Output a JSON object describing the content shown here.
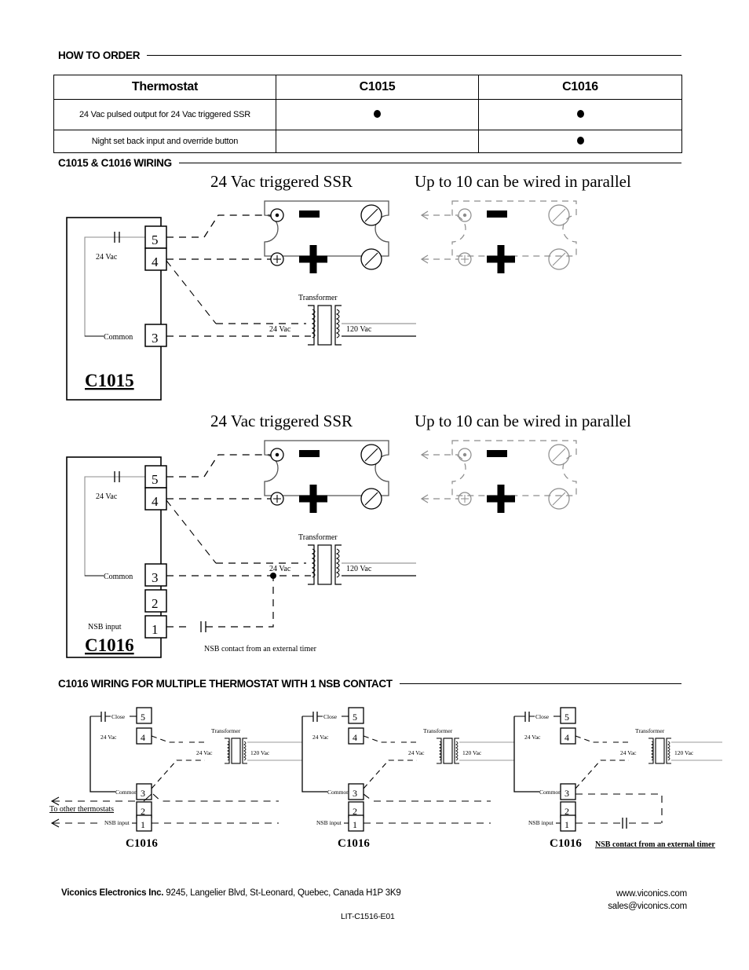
{
  "sections": {
    "how_to_order": "HOW TO ORDER",
    "wiring": "C1015 & C1016 WIRING",
    "multi": "C1016 WIRING FOR MULTIPLE THERMOSTAT WITH 1 NSB CONTACT"
  },
  "order_table": {
    "headers": [
      "Thermostat",
      "C1015",
      "C1016"
    ],
    "rows": [
      {
        "feature": "24 Vac pulsed output for 24 Vac triggered SSR",
        "c1015": true,
        "c1016": true
      },
      {
        "feature": "Night set back input and override button",
        "c1015": false,
        "c1016": true
      }
    ]
  },
  "diagram1": {
    "title_ssr": "24 Vac triggered SSR",
    "title_parallel": "Up to 10 can be wired in parallel",
    "model": "C1015",
    "terminals": [
      "5",
      "4",
      "3"
    ],
    "label_24vac": "24 Vac",
    "label_common": "Common",
    "transformer": "Transformer",
    "xfmr_primary": "24 Vac",
    "xfmr_secondary": "120 Vac",
    "ssr_minus": "−",
    "ssr_plus": "+"
  },
  "diagram2": {
    "title_ssr": "24 Vac triggered SSR",
    "title_parallel": "Up to 10 can be wired in parallel",
    "model": "C1016",
    "terminals": [
      "5",
      "4",
      "3",
      "2",
      "1"
    ],
    "label_24vac": "24 Vac",
    "label_common": "Common",
    "label_nsb": "NSB input",
    "transformer": "Transformer",
    "xfmr_primary": "24 Vac",
    "xfmr_secondary": "120 Vac",
    "nsb_note": "NSB contact from an external timer"
  },
  "diagram3": {
    "units": [
      {
        "model": "C1016"
      },
      {
        "model": "C1016"
      },
      {
        "model": "C1016"
      }
    ],
    "terminals": [
      "5",
      "4",
      "3",
      "2",
      "1"
    ],
    "label_close": "Close",
    "label_24vac": "24 Vac",
    "label_common": "Common",
    "label_nsb": "NSB input",
    "transformer": "Transformer",
    "xfmr_primary": "24 Vac",
    "xfmr_secondary": "120 Vac",
    "to_other": "To other thermostats",
    "nsb_note": "NSB contact from an external timer"
  },
  "footer": {
    "company": "Viconics Electronics Inc.",
    "address": "9245, Langelier Blvd, St-Leonard, Quebec, Canada H1P 3K9",
    "website": "www.viconics.com",
    "email": "sales@viconics.com",
    "doc_code": "LIT-C1516-E01"
  },
  "colors": {
    "ink": "#000000",
    "faint": "#9a9a9a",
    "ghost": "#8c8c8c"
  }
}
